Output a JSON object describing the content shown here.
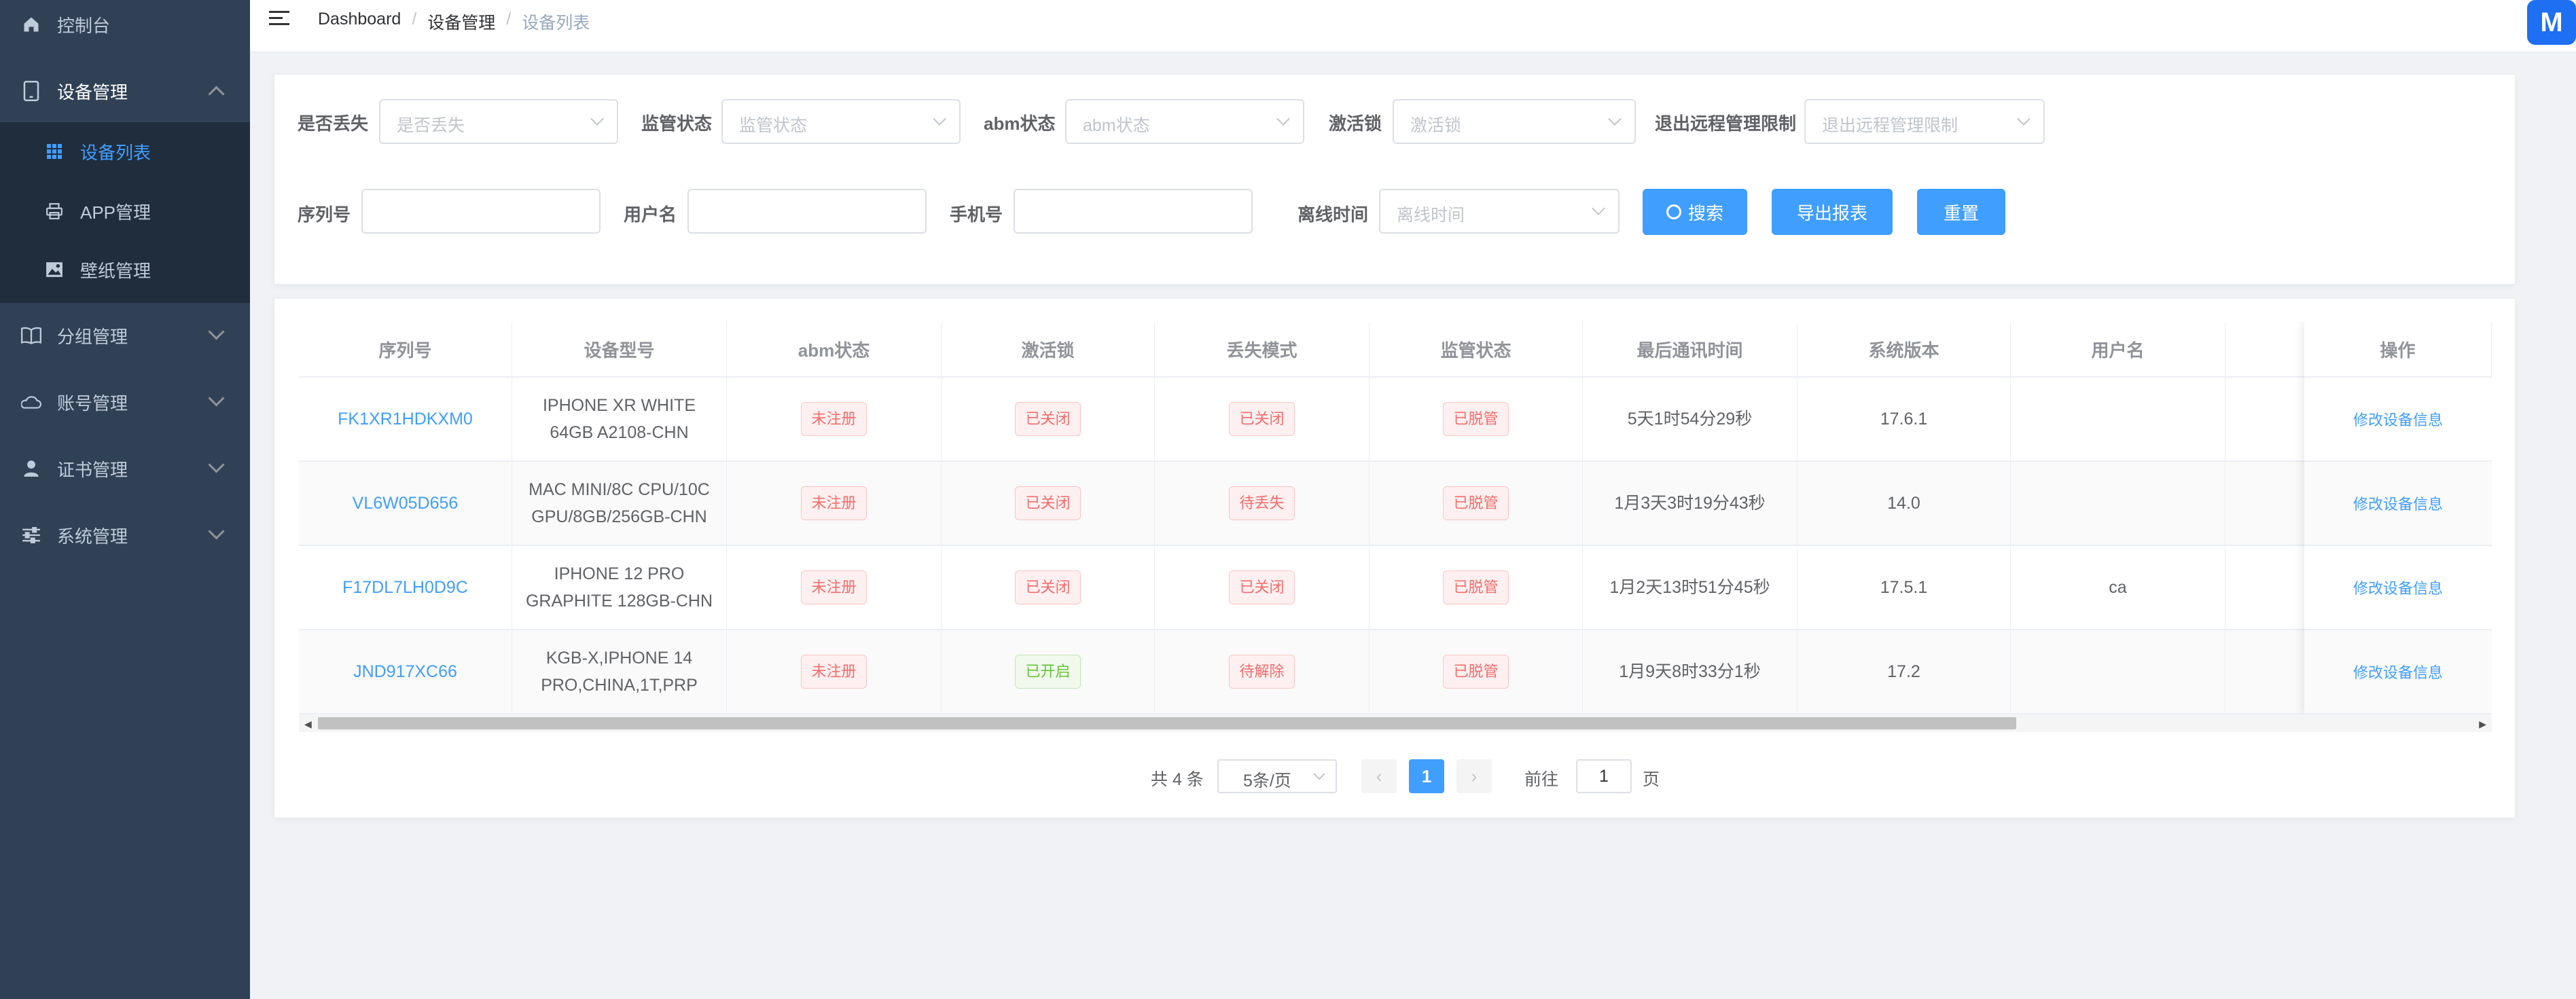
{
  "sidebar": {
    "items": [
      {
        "label": "控制台",
        "icon": "home-icon"
      },
      {
        "label": "设备管理",
        "icon": "tablet-icon",
        "expanded": true
      },
      {
        "label": "分组管理",
        "icon": "book-icon"
      },
      {
        "label": "账号管理",
        "icon": "cloud-icon"
      },
      {
        "label": "证书管理",
        "icon": "user-icon"
      },
      {
        "label": "系统管理",
        "icon": "sliders-icon"
      }
    ],
    "subitems": [
      {
        "label": "设备列表",
        "icon": "grid-icon",
        "active": true
      },
      {
        "label": "APP管理",
        "icon": "printer-icon"
      },
      {
        "label": "壁纸管理",
        "icon": "picture-icon"
      }
    ]
  },
  "breadcrumb": {
    "root": "Dashboard",
    "sep": "/",
    "parent": "设备管理",
    "current": "设备列表"
  },
  "logo": {
    "text": "M"
  },
  "filters": {
    "lost": {
      "label": "是否丢失",
      "placeholder": "是否丢失"
    },
    "supervise": {
      "label": "监管状态",
      "placeholder": "监管状态"
    },
    "abm": {
      "label": "abm状态",
      "placeholder": "abm状态"
    },
    "activation": {
      "label": "激活锁",
      "placeholder": "激活锁"
    },
    "remote": {
      "label": "退出远程管理限制",
      "placeholder": "退出远程管理限制"
    },
    "serial": {
      "label": "序列号"
    },
    "username": {
      "label": "用户名"
    },
    "phone": {
      "label": "手机号"
    },
    "offline": {
      "label": "离线时间",
      "placeholder": "离线时间"
    },
    "search_btn": "搜索",
    "export_btn": "导出报表",
    "reset_btn": "重置"
  },
  "table": {
    "headers": [
      "序列号",
      "设备型号",
      "abm状态",
      "激活锁",
      "丢失模式",
      "监管状态",
      "最后通讯时间",
      "系统版本",
      "用户名",
      "",
      "操作"
    ],
    "rows": [
      {
        "serial": "FK1XR1HDKXM0",
        "model": "IPHONE XR WHITE 64GB A2108-CHN",
        "abm": "未注册",
        "lock": "已关闭",
        "lost": "已关闭",
        "supervise": "已脱管",
        "last": "5天1时54分29秒",
        "os": "17.6.1",
        "user": "",
        "action": "修改设备信息"
      },
      {
        "serial": "VL6W05D656",
        "model": "MAC MINI/8C CPU/10C GPU/8GB/256GB-CHN",
        "abm": "未注册",
        "lock": "已关闭",
        "lost": "待丢失",
        "supervise": "已脱管",
        "last": "1月3天3时19分43秒",
        "os": "14.0",
        "user": "",
        "action": "修改设备信息"
      },
      {
        "serial": "F17DL7LH0D9C",
        "model": "IPHONE 12 PRO GRAPHITE 128GB-CHN",
        "abm": "未注册",
        "lock": "已关闭",
        "lost": "已关闭",
        "supervise": "已脱管",
        "last": "1月2天13时51分45秒",
        "os": "17.5.1",
        "user": "ca",
        "action": "修改设备信息"
      },
      {
        "serial": "JND917XC66",
        "model": "KGB-X,IPHONE 14 PRO,CHINA,1T,PRP",
        "abm": "未注册",
        "lock": "已开启",
        "lost": "待解除",
        "supervise": "已脱管",
        "last": "1月9天8时33分1秒",
        "os": "17.2",
        "user": "",
        "action": "修改设备信息"
      }
    ]
  },
  "pagination": {
    "total": "共 4 条",
    "page_size": "5条/页",
    "current": "1",
    "goto": "前往",
    "jump_value": "1",
    "page_suffix": "页",
    "prev": "‹",
    "next": "›"
  },
  "colors": {
    "sidebar": "#304156",
    "submenu": "#1f2d3d",
    "primary": "#409eff",
    "danger": "#f56c6c",
    "success": "#67c23a"
  }
}
